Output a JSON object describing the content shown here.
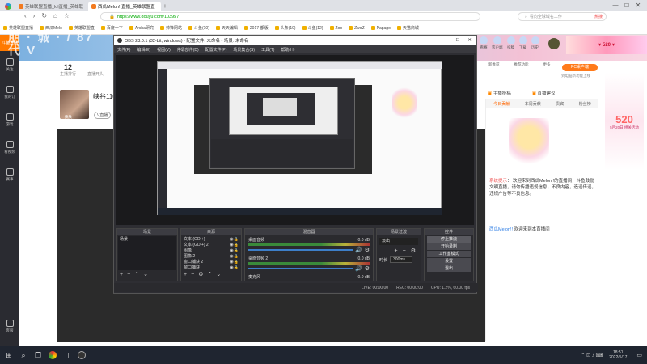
{
  "browser": {
    "tabs": [
      {
        "label": "英雄联盟直播_lol直播_英雄联"
      },
      {
        "label": "西瓜Melon!!直播_英雄联盟直"
      }
    ],
    "address": "https://www.douyu.com/103957",
    "search_placeholder": "看向全球域名工作",
    "hot_label": "热搜",
    "bookmarks": [
      "英雄联盟直播",
      "西瓜Melo",
      "英雄联盟直",
      "百度一下",
      "Archa研究",
      "帅锋网站",
      "斗鱼(10)",
      "天天编辑",
      "2017-都版",
      "头条(10)",
      "斗鱼(12)",
      "Zoo",
      "ZwoZ",
      "Papago",
      "天猫商城"
    ]
  },
  "left_nav": {
    "logo_text": "斗鱼直播",
    "items": [
      "关注",
      "我的订",
      "游戏",
      "看视频",
      "赛事"
    ],
    "bottom": "客服"
  },
  "streamer": {
    "number": "12",
    "follow_label": "主播排行",
    "level_label": "直播开头",
    "name": "峡谷110",
    "badge": "V直播",
    "avatar_caption": "换肤"
  },
  "banner": {
    "text": "朋 · 城 · / 87 代 V"
  },
  "top_right": {
    "icons": [
      "看赛",
      "客户端",
      "投稿",
      "下载",
      "历史"
    ],
    "feature_labels": [
      "新推荐",
      "推荐功能",
      "更多"
    ],
    "pc_button": "PC桌户端",
    "pc_sub": "到电脑新功能上线",
    "streamer_action": "主播投稿",
    "share_action": "直播建议"
  },
  "right_panel": {
    "tabs": [
      "今日贡献",
      "本周贡献",
      "贵宾",
      "粉丝榜"
    ],
    "system_tag": "系统提示",
    "system_msg": "欢迎来到西瓜Melon!!的直播间，斗鱼鼓励文明直播，请勿传播违规信息，不良内容，造谣传谣，违规广告等不良信息。",
    "chat_user": "西瓜Melon!!",
    "chat_msg": "欢迎来到本直播间"
  },
  "promo": {
    "big": "520",
    "sub": "5月20日 相关活动"
  },
  "obs": {
    "title": "OBS 23.0.1 (32-bit, windows) - 配置文件: 未命名 - 场景: 未命名",
    "menu": [
      "文件(F)",
      "编辑(E)",
      "视图(V)",
      "停靠部件(D)",
      "配置文件(P)",
      "场景集合(S)",
      "工具(T)",
      "帮助(H)"
    ],
    "docks": {
      "scenes": {
        "title": "场景",
        "items": [
          "场景"
        ]
      },
      "sources": {
        "title": "来源",
        "items": [
          "文本 (GDI+)",
          "文本 (GDI+) 2",
          "图像",
          "图像 2",
          "窗口捕获 2",
          "窗口捕获"
        ]
      },
      "mixer": {
        "title": "混音器",
        "tracks": [
          {
            "name": "桌面音频",
            "db": "0.0 dB"
          },
          {
            "name": "桌面音频 2",
            "db": "0.0 dB"
          },
          {
            "name": "麦克风",
            "db": "0.0 dB"
          }
        ]
      },
      "transitions": {
        "title": "场景过渡",
        "type": "淡出",
        "duration_label": "时长",
        "duration_value": "300ms"
      },
      "controls": {
        "title": "控件",
        "buttons": [
          "停止推流",
          "开始录制",
          "工作室模式",
          "设置",
          "退出"
        ]
      }
    },
    "status": [
      "LIVE: 00:00:00",
      "REC: 00:00:00",
      "CPU: 1.2%, 60.00 fps"
    ]
  },
  "taskbar": {
    "time": "18:51",
    "date": "2022/5/17"
  }
}
